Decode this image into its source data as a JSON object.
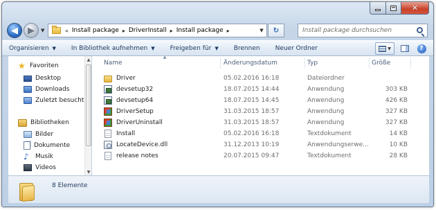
{
  "window": {
    "caption": {
      "minimize_icon": "minimize-icon",
      "maximize_icon": "maximize-icon",
      "close_icon": "close-icon"
    }
  },
  "address": {
    "overflow": "«",
    "crumbs": [
      "Install package",
      "DriverInstall",
      "Install package"
    ],
    "separator": "▸"
  },
  "search": {
    "placeholder": "Install package durchsuchen"
  },
  "toolbar": {
    "organize": "Organisieren",
    "include_library": "In Bibliothek aufnehmen",
    "share": "Freigeben für",
    "burn": "Brennen",
    "new_folder": "Neuer Ordner"
  },
  "nav": {
    "favorites": {
      "label": "Favoriten",
      "items": [
        "Desktop",
        "Downloads",
        "Zuletzt besucht"
      ]
    },
    "libraries": {
      "label": "Bibliotheken",
      "items": [
        "Bilder",
        "Dokumente",
        "Musik",
        "Videos"
      ]
    }
  },
  "columns": {
    "name": "Name",
    "date": "Änderungsdatum",
    "type": "Typ",
    "size": "Größe"
  },
  "files": [
    {
      "name": "Driver",
      "date": "05.02.2016 16:18",
      "type": "Dateiordner",
      "size": "",
      "icon": "folder-icon"
    },
    {
      "name": "devsetup32",
      "date": "18.07.2015 14:44",
      "type": "Anwendung",
      "size": "303 KB",
      "icon": "application-icon"
    },
    {
      "name": "devsetup64",
      "date": "18.07.2015 14:45",
      "type": "Anwendung",
      "size": "426 KB",
      "icon": "application-icon"
    },
    {
      "name": "DriverSetup",
      "date": "31.03.2015 18:57",
      "type": "Anwendung",
      "size": "327 KB",
      "icon": "setup-icon"
    },
    {
      "name": "DriverUninstall",
      "date": "31.03.2015 18:57",
      "type": "Anwendung",
      "size": "327 KB",
      "icon": "setup-icon"
    },
    {
      "name": "Install",
      "date": "05.02.2016 16:18",
      "type": "Textdokument",
      "size": "14 KB",
      "icon": "text-file-icon"
    },
    {
      "name": "LocateDevice.dll",
      "date": "31.12.2013 10:19",
      "type": "Anwendungserwe...",
      "size": "10 KB",
      "icon": "dll-icon"
    },
    {
      "name": "release notes",
      "date": "20.07.2015 09:47",
      "type": "Textdokument",
      "size": "28 KB",
      "icon": "text-file-icon"
    }
  ],
  "status": {
    "count": "8 Elemente"
  }
}
